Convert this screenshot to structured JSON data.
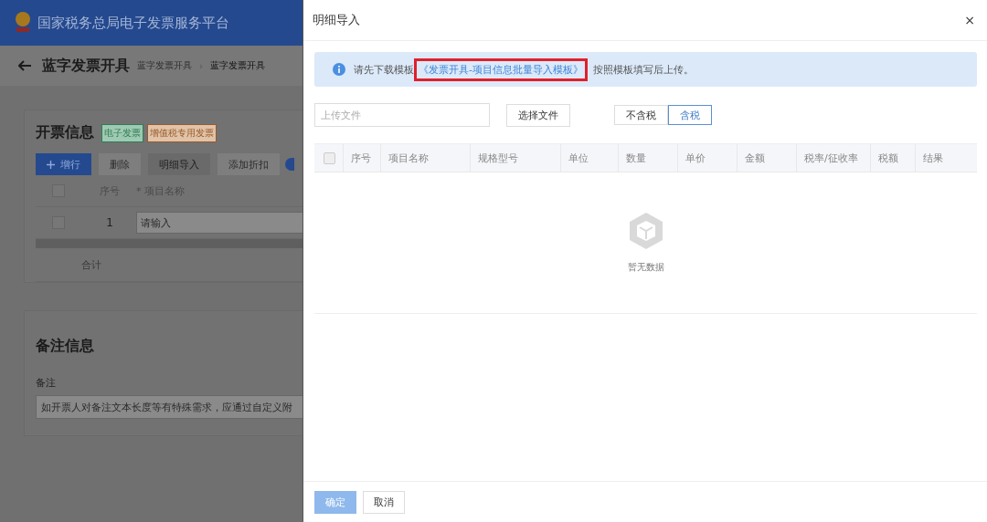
{
  "app_header": {
    "title": "国家税务总局电子发票服务平台"
  },
  "page": {
    "title": "蓝字发票开具",
    "breadcrumb": [
      "蓝字发票开具",
      "蓝字发票开具"
    ],
    "breadcrumb_separator": "›"
  },
  "invoice_section": {
    "title": "开票信息",
    "tags": [
      {
        "label": "电子发票",
        "color": "#2e7d55"
      },
      {
        "label": "增值税专用发票",
        "color": "#9a5a2a"
      }
    ],
    "buttons": [
      {
        "label": "增行",
        "kind": "primary",
        "disabled": false
      },
      {
        "label": "删除",
        "kind": "default",
        "disabled": true
      },
      {
        "label": "明细导入",
        "kind": "default",
        "disabled": false
      },
      {
        "label": "添加折扣",
        "kind": "default",
        "disabled": true
      }
    ],
    "columns": [
      "序号",
      "* 项目名称"
    ],
    "header_checked": false,
    "rows": [
      {
        "index": "1",
        "placeholder": "请输入",
        "checked": false
      }
    ],
    "total_label": "合计"
  },
  "remarks_section": {
    "title": "备注信息",
    "field_label": "备注",
    "placeholder": "如开票人对备注文本长度等有特殊需求，应通过自定义附"
  },
  "dialog": {
    "title": "明细导入",
    "close": "×",
    "notice": {
      "before": "请先下载模板",
      "link": "《发票开具-项目信息批量导入模板》",
      "link_highlighted": true,
      "after": "按照模板填写后上传。"
    },
    "upload": {
      "placeholder": "上传文件",
      "button": "选择文件"
    },
    "tax_mode": [
      {
        "label": "不含税",
        "selected": false
      },
      {
        "label": "含税",
        "selected": true
      }
    ],
    "columns": [
      "序号",
      "项目名称",
      "规格型号",
      "单位",
      "数量",
      "单价",
      "金额",
      "税率/征收率",
      "税额",
      "结果"
    ],
    "header_checked": false,
    "empty_text": "暂无数据",
    "buttons": [
      {
        "label": "确定",
        "kind": "primary",
        "disabled": true
      },
      {
        "label": "取消",
        "kind": "default",
        "disabled": false
      }
    ]
  }
}
